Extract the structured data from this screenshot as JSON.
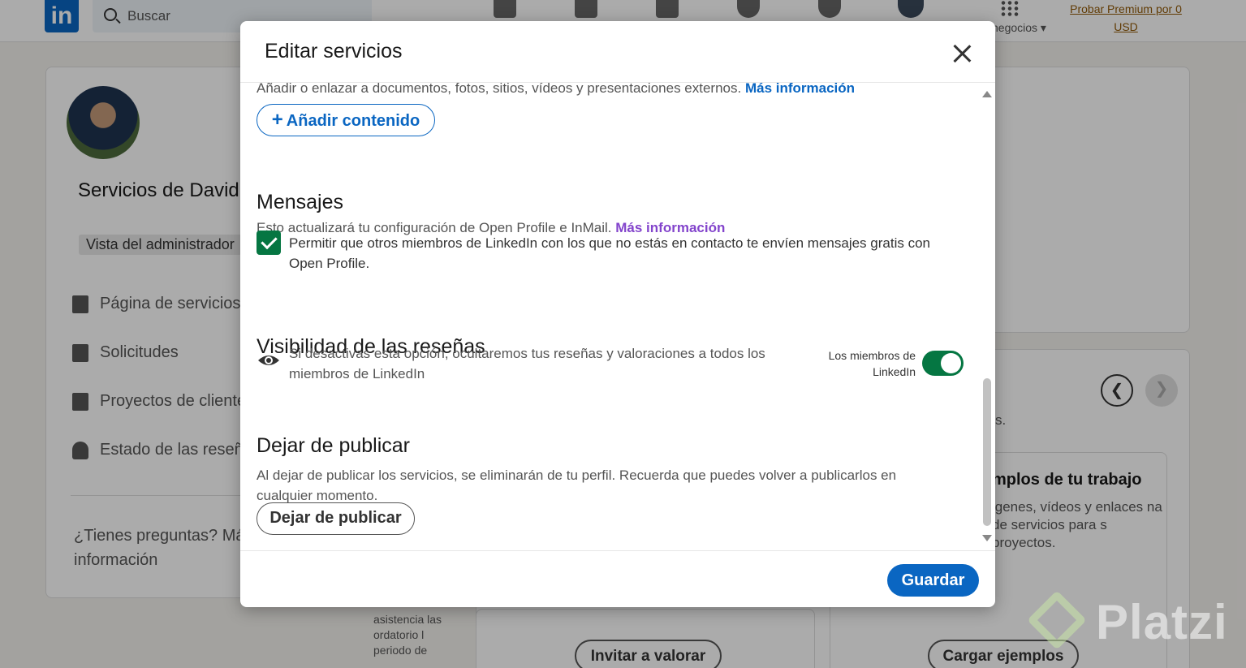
{
  "topnav": {
    "search_placeholder": "Buscar",
    "business_label": "negocios",
    "premium_line1": "Probar Premium por 0",
    "premium_line2": "USD"
  },
  "left_card": {
    "title": "Servicios de David Santana",
    "admin_badge": "Vista del administrador",
    "nav": [
      {
        "label": "Página de servicios",
        "icon": "building-icon"
      },
      {
        "label": "Solicitudes",
        "icon": "folder-icon"
      },
      {
        "label": "Proyectos de clientes",
        "icon": "book-icon"
      },
      {
        "label": "Estado de las reseñas",
        "icon": "person-icon"
      }
    ],
    "faq": "¿Tienes preguntas? Más información"
  },
  "background": {
    "side_s": "s.",
    "examples_title": "mplos de tu trabajo",
    "examples_body": "igenes, vídeos y enlaces na de servicios para s proyectos.",
    "mid_text": "asistencia las ordatorio l periodo de",
    "invite_button": "Invitar a valorar",
    "upload_button": "Cargar ejemplos",
    "watermark": "Platzi"
  },
  "modal": {
    "title": "Editar servicios",
    "content_text": "Añadir o enlazar a documentos, fotos, sitios, vídeos y presentaciones externos.",
    "content_link": "Más información",
    "add_content_label": "Añadir contenido",
    "messages": {
      "heading": "Mensajes",
      "description": "Esto actualizará tu configuración de Open Profile e InMail.",
      "link": "Más información",
      "checkbox_label": "Permitir que otros miembros de LinkedIn con los que no estás en contacto te envíen mensajes gratis con Open Profile.",
      "checked": true
    },
    "reviews": {
      "heading": "Visibilidad de las reseñas",
      "description": "Si desactivas esta opción, ocultaremos tus reseñas y valoraciones a todos los miembros de LinkedIn",
      "toggle_label": "Los miembros de LinkedIn",
      "toggle_on": true
    },
    "unpublish": {
      "heading": "Dejar de publicar",
      "description": "Al dejar de publicar los servicios, se eliminarán de tu perfil. Recuerda que puedes volver a publicarlos en cualquier momento.",
      "button": "Dejar de publicar"
    },
    "save_label": "Guardar"
  },
  "colors": {
    "brand_blue": "#0a66c2",
    "toggle_green": "#057642",
    "link_purple": "#8344cc"
  }
}
